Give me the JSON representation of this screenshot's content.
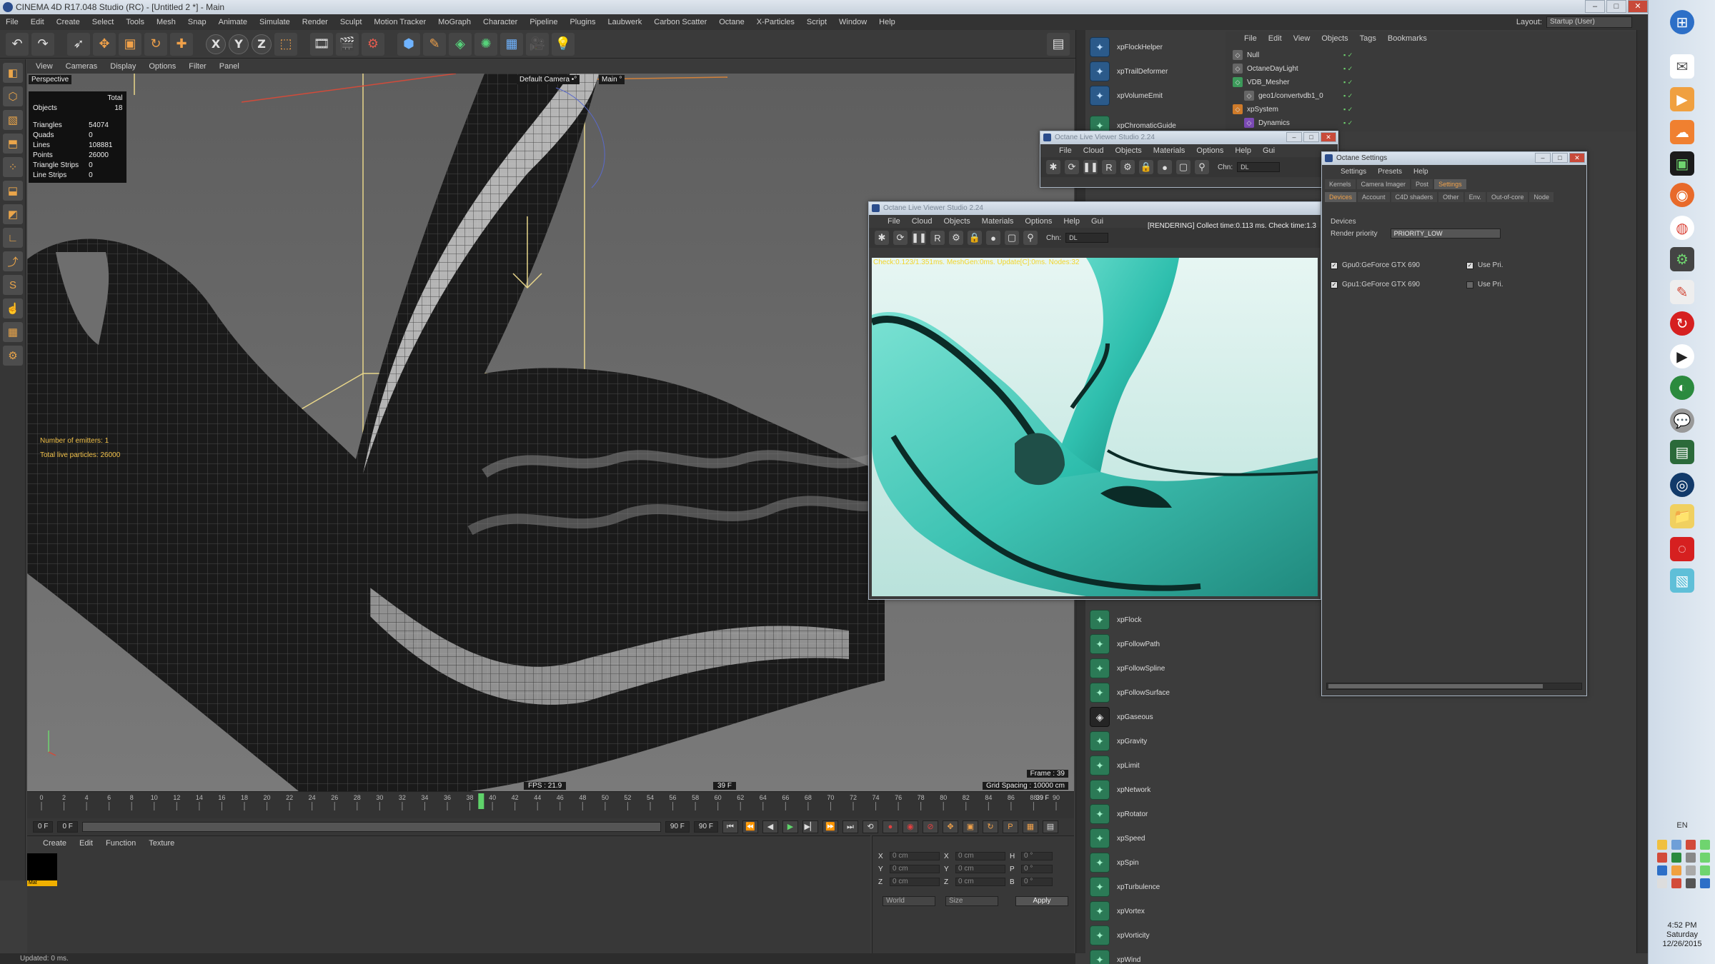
{
  "window": {
    "title": "CINEMA 4D R17.048 Studio (RC) - [Untitled 2 *] - Main",
    "controls": [
      "–",
      "□",
      "✕"
    ]
  },
  "menu": {
    "items": [
      "File",
      "Edit",
      "Create",
      "Select",
      "Tools",
      "Mesh",
      "Snap",
      "Animate",
      "Simulate",
      "Render",
      "Sculpt",
      "Motion Tracker",
      "MoGraph",
      "Character",
      "Pipeline",
      "Plugins",
      "Laubwerk",
      "Carbon Scatter",
      "Octane",
      "X-Particles",
      "Script",
      "Window",
      "Help"
    ],
    "layout_label": "Layout:",
    "layout_value": "Startup (User)"
  },
  "toolbar": {
    "icons": [
      "undo-icon",
      "select-icon",
      "move-icon",
      "scale-icon",
      "rotate-icon",
      "live-select-icon",
      "x-axis-icon",
      "y-axis-icon",
      "z-axis-icon",
      "coord-system-icon",
      "render-view-icon",
      "render-picture-viewer-icon",
      "render-settings-icon",
      "cube-icon",
      "pen-icon",
      "subdivision-icon",
      "array-icon",
      "floor-icon",
      "camera-icon",
      "light-icon"
    ],
    "axis_x": "X",
    "axis_y": "Y",
    "axis_z": "Z"
  },
  "viewport": {
    "menu": [
      "View",
      "Cameras",
      "Display",
      "Options",
      "Filter",
      "Panel"
    ],
    "label": "Perspective",
    "camera_label": "Default Camera •°",
    "main_label": "Main °",
    "stats_header": "Total",
    "objects_label": "Objects",
    "objects_value": "18",
    "stats": [
      {
        "label": "Triangles",
        "value": "54074"
      },
      {
        "label": "Quads",
        "value": "0"
      },
      {
        "label": "Lines",
        "value": "108881"
      },
      {
        "label": "Points",
        "value": "26000"
      },
      {
        "label": "Triangle Strips",
        "value": "0"
      },
      {
        "label": "Line Strips",
        "value": "0"
      }
    ],
    "emitters_label": "Number of emitters: 1",
    "particles_label": "Total live particles: 26000",
    "fps": "FPS : 21.9",
    "fps_right": "39 F",
    "frame": "Frame : 39",
    "grid_spacing": "Grid Spacing : 10000 cm"
  },
  "timeline": {
    "ticks": [
      "0",
      "2",
      "4",
      "6",
      "8",
      "10",
      "12",
      "14",
      "16",
      "18",
      "20",
      "22",
      "24",
      "26",
      "28",
      "30",
      "32",
      "34",
      "36",
      "38",
      "40",
      "42",
      "44",
      "46",
      "48",
      "50",
      "52",
      "54",
      "56",
      "58",
      "60",
      "62",
      "64",
      "66",
      "68",
      "70",
      "72",
      "74",
      "76",
      "78",
      "80",
      "82",
      "84",
      "86",
      "88",
      "90"
    ],
    "current_frame": 39,
    "current_label": "39 F",
    "start": "0 F",
    "start2": "0 F",
    "end": "90 F",
    "end2": "90 F"
  },
  "material_manager": {
    "menu": [
      "Create",
      "Edit",
      "Function",
      "Texture"
    ],
    "swatch_label": "Mat"
  },
  "coords": {
    "rows": [
      {
        "a": "X",
        "av": "0 cm",
        "b": "X",
        "bv": "0 cm",
        "c": "H",
        "cv": "0 °"
      },
      {
        "a": "Y",
        "av": "0 cm",
        "b": "Y",
        "bv": "0 cm",
        "c": "P",
        "cv": "0 °"
      },
      {
        "a": "Z",
        "av": "0 cm",
        "b": "Z",
        "bv": "0 cm",
        "c": "B",
        "cv": "0 °"
      }
    ],
    "mode1": "World",
    "mode2": "Size",
    "apply": "Apply"
  },
  "status": "Updated: 0 ms.",
  "xp_palette": [
    {
      "label": "xpFlockHelper",
      "icon": "flock-helper-icon",
      "kind": "blue"
    },
    {
      "label": "xpTrailDeformer",
      "icon": "trail-deformer-icon",
      "kind": "blue"
    },
    {
      "label": "xpVolumeEmit",
      "icon": "volume-emit-icon",
      "kind": "blue"
    },
    {
      "label": "xpChromaticGuide",
      "icon": "chromatic-guide-icon",
      "kind": "green"
    },
    {
      "label": "xpFlock",
      "icon": "flock-icon",
      "kind": "green"
    },
    {
      "label": "xpFollowPath",
      "icon": "follow-path-icon",
      "kind": "green"
    },
    {
      "label": "xpFollowSpline",
      "icon": "follow-spline-icon",
      "kind": "green"
    },
    {
      "label": "xpFollowSurface",
      "icon": "follow-surface-icon",
      "kind": "green"
    },
    {
      "label": "xpGaseous",
      "icon": "gaseous-icon",
      "kind": "dark"
    },
    {
      "label": "xpGravity",
      "icon": "gravity-icon",
      "kind": "green"
    },
    {
      "label": "xpLimit",
      "icon": "limit-icon",
      "kind": "green"
    },
    {
      "label": "xpNetwork",
      "icon": "network-icon",
      "kind": "green"
    },
    {
      "label": "xpRotator",
      "icon": "rotator-icon",
      "kind": "green"
    },
    {
      "label": "xpSpeed",
      "icon": "speed-icon",
      "kind": "green"
    },
    {
      "label": "xpSpin",
      "icon": "spin-icon",
      "kind": "green"
    },
    {
      "label": "xpTurbulence",
      "icon": "turbulence-icon",
      "kind": "green"
    },
    {
      "label": "xpVortex",
      "icon": "vortex-icon",
      "kind": "green"
    },
    {
      "label": "xpVorticity",
      "icon": "vorticity-icon",
      "kind": "green"
    },
    {
      "label": "xpWind",
      "icon": "wind-icon",
      "kind": "green"
    }
  ],
  "object_manager": {
    "menu": [
      "File",
      "Edit",
      "View",
      "Objects",
      "Tags",
      "Bookmarks"
    ],
    "rows": [
      {
        "label": "Null",
        "indent": 0,
        "kind": "gray"
      },
      {
        "label": "OctaneDayLight",
        "indent": 0,
        "kind": "gray"
      },
      {
        "label": "VDB_Mesher",
        "indent": 0,
        "kind": "green"
      },
      {
        "label": "geo1/convertvdb1_0",
        "indent": 1,
        "kind": "gray"
      },
      {
        "label": "xpSystem",
        "indent": 0,
        "kind": "orange"
      },
      {
        "label": "Dynamics",
        "indent": 1,
        "kind": "purple"
      }
    ]
  },
  "live_viewer": {
    "title": "Octane Live Viewer Studio 2.24",
    "menu": [
      "File",
      "Cloud",
      "Objects",
      "Materials",
      "Options",
      "Help",
      "Gui"
    ],
    "status": "[RENDERING] Collect time:0.113 ms.  Check time:1.3",
    "channel_label": "Chn:",
    "channel_value": "DL",
    "render_info": "Check:0.123/1.351ms. MeshGen:0ms. Update[C]:0ms. Nodes:32"
  },
  "live_viewer_back": {
    "title": "Octane Live Viewer Studio 2.24",
    "menu": [
      "File",
      "Cloud",
      "Objects",
      "Materials",
      "Options",
      "Help",
      "Gui"
    ],
    "channel_label": "Chn:",
    "channel_value": "DL"
  },
  "octane_settings": {
    "title": "Octane Settings",
    "menu": [
      "Settings",
      "Presets",
      "Help"
    ],
    "tabs": [
      "Kernels",
      "Camera Imager",
      "Post",
      "Settings"
    ],
    "active_tab": "Settings",
    "subtabs": [
      "Devices",
      "Account",
      "C4D shaders",
      "Other",
      "Env.",
      "Out-of-core",
      "Node"
    ],
    "active_subtab": "Devices",
    "section": "Devices",
    "render_priority_label": "Render priority",
    "render_priority_value": "PRIORITY_LOW",
    "gpus": [
      {
        "label": "Gpu0:GeForce GTX 690",
        "checked": true,
        "use_label": "Use Pri.",
        "use_checked": true
      },
      {
        "label": "Gpu1:GeForce GTX 690",
        "checked": true,
        "use_label": "Use Pri.",
        "use_checked": false
      }
    ]
  },
  "taskbar": {
    "language": "EN",
    "time": "4:52 PM",
    "day": "Saturday",
    "date": "12/26/2015"
  }
}
